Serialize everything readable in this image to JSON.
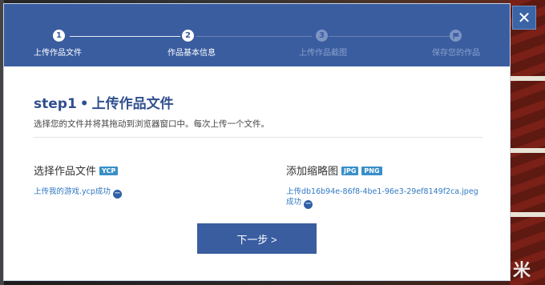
{
  "steps": [
    {
      "number": "1",
      "label": "上传作品文件",
      "state": "done"
    },
    {
      "number": "2",
      "label": "作品基本信息",
      "state": "current"
    },
    {
      "number": "3",
      "label": "上传作品截图",
      "state": "upcoming"
    },
    {
      "number": "",
      "label": "保存您的作品",
      "state": "upcoming",
      "icon": "flag-icon"
    }
  ],
  "main": {
    "title_step": "step1",
    "title_dot": "•",
    "title_text": "上传作品文件",
    "description": "选择您的文件并将其拖动到浏览器窗口中。每次上传一个文件。"
  },
  "file_section": {
    "label": "选择作品文件",
    "tags": [
      "YCP"
    ],
    "status": "上传我的游戏.ycp成功"
  },
  "thumb_section": {
    "label": "添加缩略图",
    "tags": [
      "JPG",
      "PNG"
    ],
    "status_line1": "上传db16b94e-86f8-4be1-96e3-29ef8149f2ca.jpeg",
    "status_line2": "成功"
  },
  "next_button": "下一步 >",
  "close_glyph": "✕",
  "watermark": "米",
  "colors": {
    "primary": "#3a5da0",
    "link": "#2f78c4",
    "tag": "#3a8fc9"
  }
}
